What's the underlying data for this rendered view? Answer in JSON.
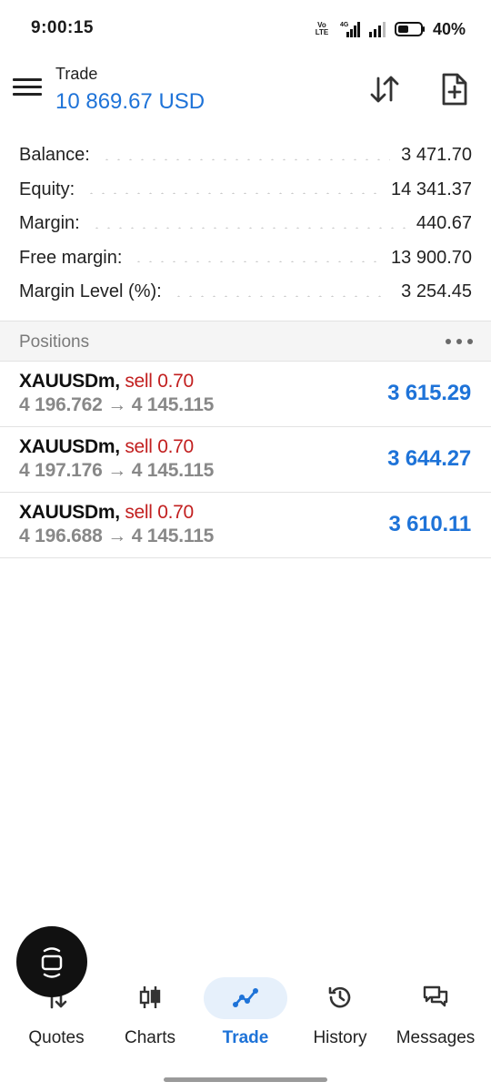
{
  "status_bar": {
    "time": "9:00:15",
    "network_label": "Vo LTE",
    "network_type": "4G",
    "battery": "40%"
  },
  "header": {
    "title": "Trade",
    "balance": "10 869.67 USD",
    "menu_icon": "hamburger-menu-icon",
    "sort_icon": "sort-arrows-icon",
    "new_order_icon": "new-document-icon"
  },
  "summary": [
    {
      "label": "Balance:",
      "value": "3 471.70"
    },
    {
      "label": "Equity:",
      "value": "14 341.37"
    },
    {
      "label": "Margin:",
      "value": "440.67"
    },
    {
      "label": "Free margin:",
      "value": "13 900.70"
    },
    {
      "label": "Margin Level (%):",
      "value": "3 254.45"
    }
  ],
  "positions_header": {
    "title": "Positions",
    "more_icon": "more-dots-icon"
  },
  "positions": [
    {
      "symbol": "XAUUSDm,",
      "side": "sell 0.70",
      "prices": "4 196.762 → 4 145.115",
      "profit": "3 615.29"
    },
    {
      "symbol": "XAUUSDm,",
      "side": "sell 0.70",
      "prices": "4 197.176 → 4 145.115",
      "profit": "3 644.27"
    },
    {
      "symbol": "XAUUSDm,",
      "side": "sell 0.70",
      "prices": "4 196.688 → 4 145.115",
      "profit": "3 610.11"
    }
  ],
  "nav": {
    "quotes": "Quotes",
    "charts": "Charts",
    "trade": "Trade",
    "history": "History",
    "messages": "Messages",
    "active": "Trade"
  },
  "colors": {
    "accent": "#1e73d8",
    "sell": "#c21f1f",
    "muted": "#888888"
  }
}
